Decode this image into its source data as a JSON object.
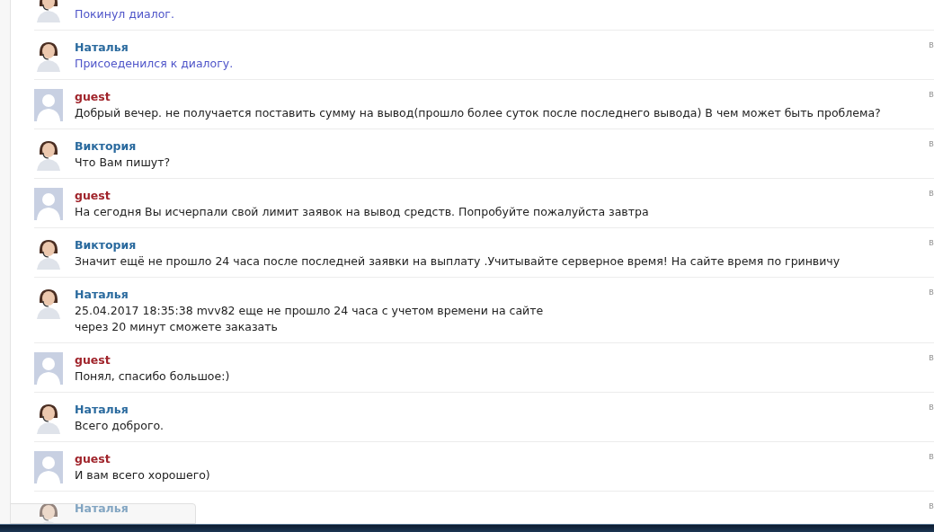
{
  "messages": [
    {
      "kind": "operator",
      "system": true,
      "lines": [
        "Покинул диалог."
      ]
    },
    {
      "kind": "operator",
      "author": "Наталья",
      "system": true,
      "time": "в",
      "lines": [
        "Присоеденился к диалогу."
      ]
    },
    {
      "kind": "guest",
      "author": "guest",
      "system": false,
      "time": "в",
      "lines": [
        "Добрый вечер. не получается поставить сумму на вывод(прошло более суток после последнего вывода) В чем может быть проблема?"
      ]
    },
    {
      "kind": "operator",
      "author": "Виктория",
      "system": false,
      "time": "в",
      "lines": [
        "Что Вам пишут?"
      ]
    },
    {
      "kind": "guest",
      "author": "guest",
      "system": false,
      "time": "в",
      "lines": [
        "На сегодня Вы исчерпали свой лимит заявок на вывод средств. Попробуйте пожалуйста завтра"
      ]
    },
    {
      "kind": "operator",
      "author": "Виктория",
      "system": false,
      "time": "в",
      "lines": [
        "Значит ещё не прошло 24 часа после последней заявки на выплату .Учитывайте серверное время! На сайте время по гринвичу"
      ]
    },
    {
      "kind": "operator",
      "author": "Наталья",
      "system": false,
      "time": "в",
      "lines": [
        "25.04.2017 18:35:38 mvv82 еще не прошло 24 часа с учетом времени на сайте",
        "через 20 минут сможете заказать"
      ]
    },
    {
      "kind": "guest",
      "author": "guest",
      "system": false,
      "time": "в",
      "lines": [
        "Понял, спасибо большое:)"
      ]
    },
    {
      "kind": "operator",
      "author": "Наталья",
      "system": false,
      "time": "в",
      "lines": [
        "Всего доброго."
      ]
    },
    {
      "kind": "guest",
      "author": "guest",
      "system": false,
      "time": "в",
      "lines": [
        "И вам всего хорошего)"
      ]
    },
    {
      "kind": "operator",
      "author": "Наталья",
      "time": "в"
    }
  ]
}
